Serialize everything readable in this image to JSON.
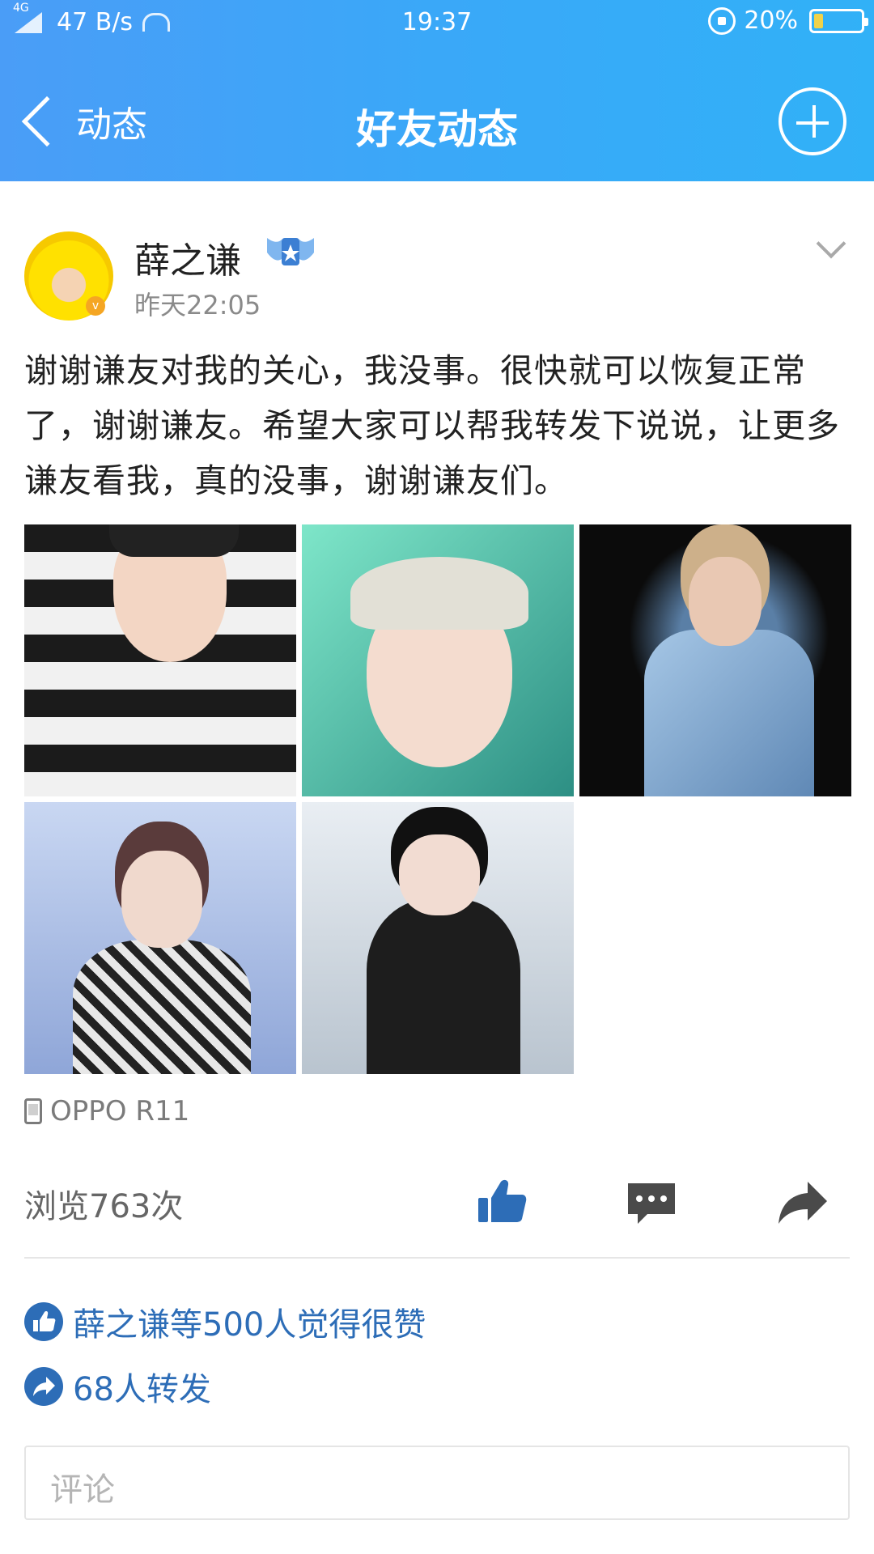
{
  "status_bar": {
    "network": "4G",
    "speed": "47 B/s",
    "time": "19:37",
    "battery_percent": "20%",
    "battery_level": 0.2
  },
  "nav": {
    "back_label": "动态",
    "title": "好友动态"
  },
  "post": {
    "username": "薛之谦",
    "avatar_badge": "v",
    "timestamp": "昨天22:05",
    "text": "谢谢谦友对我的关心，我没事。很快就可以恢复正常了，谢谢谦友。希望大家可以帮我转发下说说，让更多谦友看我，真的没事，谢谢谦友们。",
    "device": "OPPO R11",
    "views": "浏览763次",
    "likes_summary": "薛之谦等500人觉得很赞",
    "shares_summary": "68人转发"
  },
  "comment": {
    "placeholder": "评论"
  },
  "colors": {
    "header_gradient_start": "#4a9df7",
    "header_gradient_end": "#31b1f7",
    "action_icon": "#2d6db7",
    "comment_icon": "#4a4a4a"
  }
}
